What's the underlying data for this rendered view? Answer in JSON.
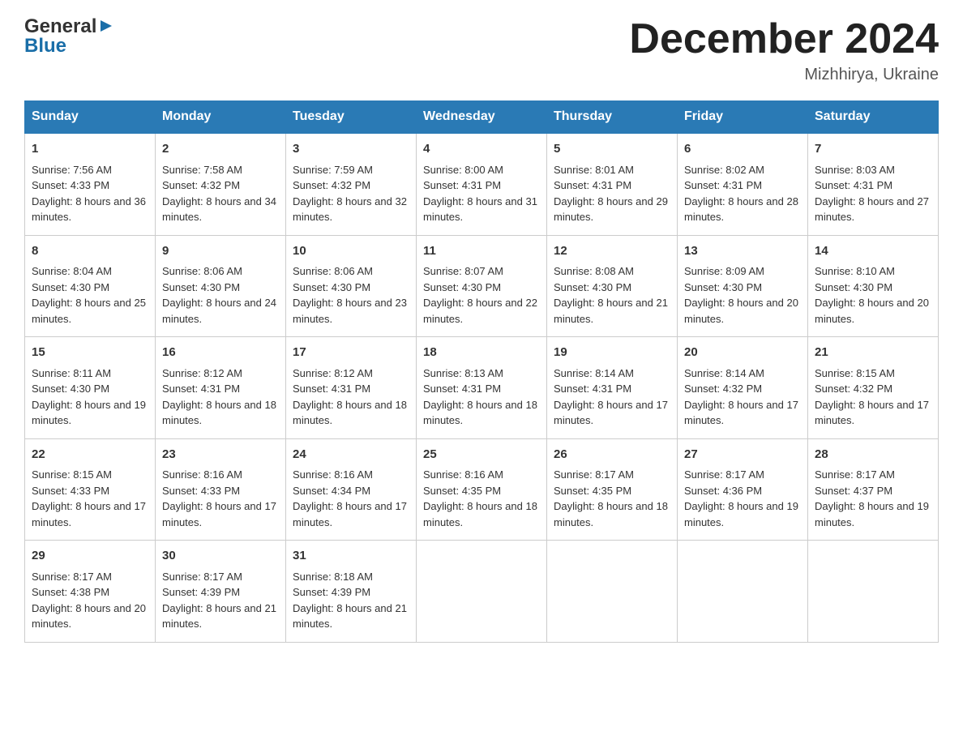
{
  "header": {
    "logo_general": "General",
    "logo_blue": "Blue",
    "month_title": "December 2024",
    "location": "Mizhhirya, Ukraine"
  },
  "days_of_week": [
    "Sunday",
    "Monday",
    "Tuesday",
    "Wednesday",
    "Thursday",
    "Friday",
    "Saturday"
  ],
  "weeks": [
    [
      {
        "day": "1",
        "sunrise": "7:56 AM",
        "sunset": "4:33 PM",
        "daylight": "8 hours and 36 minutes."
      },
      {
        "day": "2",
        "sunrise": "7:58 AM",
        "sunset": "4:32 PM",
        "daylight": "8 hours and 34 minutes."
      },
      {
        "day": "3",
        "sunrise": "7:59 AM",
        "sunset": "4:32 PM",
        "daylight": "8 hours and 32 minutes."
      },
      {
        "day": "4",
        "sunrise": "8:00 AM",
        "sunset": "4:31 PM",
        "daylight": "8 hours and 31 minutes."
      },
      {
        "day": "5",
        "sunrise": "8:01 AM",
        "sunset": "4:31 PM",
        "daylight": "8 hours and 29 minutes."
      },
      {
        "day": "6",
        "sunrise": "8:02 AM",
        "sunset": "4:31 PM",
        "daylight": "8 hours and 28 minutes."
      },
      {
        "day": "7",
        "sunrise": "8:03 AM",
        "sunset": "4:31 PM",
        "daylight": "8 hours and 27 minutes."
      }
    ],
    [
      {
        "day": "8",
        "sunrise": "8:04 AM",
        "sunset": "4:30 PM",
        "daylight": "8 hours and 25 minutes."
      },
      {
        "day": "9",
        "sunrise": "8:06 AM",
        "sunset": "4:30 PM",
        "daylight": "8 hours and 24 minutes."
      },
      {
        "day": "10",
        "sunrise": "8:06 AM",
        "sunset": "4:30 PM",
        "daylight": "8 hours and 23 minutes."
      },
      {
        "day": "11",
        "sunrise": "8:07 AM",
        "sunset": "4:30 PM",
        "daylight": "8 hours and 22 minutes."
      },
      {
        "day": "12",
        "sunrise": "8:08 AM",
        "sunset": "4:30 PM",
        "daylight": "8 hours and 21 minutes."
      },
      {
        "day": "13",
        "sunrise": "8:09 AM",
        "sunset": "4:30 PM",
        "daylight": "8 hours and 20 minutes."
      },
      {
        "day": "14",
        "sunrise": "8:10 AM",
        "sunset": "4:30 PM",
        "daylight": "8 hours and 20 minutes."
      }
    ],
    [
      {
        "day": "15",
        "sunrise": "8:11 AM",
        "sunset": "4:30 PM",
        "daylight": "8 hours and 19 minutes."
      },
      {
        "day": "16",
        "sunrise": "8:12 AM",
        "sunset": "4:31 PM",
        "daylight": "8 hours and 18 minutes."
      },
      {
        "day": "17",
        "sunrise": "8:12 AM",
        "sunset": "4:31 PM",
        "daylight": "8 hours and 18 minutes."
      },
      {
        "day": "18",
        "sunrise": "8:13 AM",
        "sunset": "4:31 PM",
        "daylight": "8 hours and 18 minutes."
      },
      {
        "day": "19",
        "sunrise": "8:14 AM",
        "sunset": "4:31 PM",
        "daylight": "8 hours and 17 minutes."
      },
      {
        "day": "20",
        "sunrise": "8:14 AM",
        "sunset": "4:32 PM",
        "daylight": "8 hours and 17 minutes."
      },
      {
        "day": "21",
        "sunrise": "8:15 AM",
        "sunset": "4:32 PM",
        "daylight": "8 hours and 17 minutes."
      }
    ],
    [
      {
        "day": "22",
        "sunrise": "8:15 AM",
        "sunset": "4:33 PM",
        "daylight": "8 hours and 17 minutes."
      },
      {
        "day": "23",
        "sunrise": "8:16 AM",
        "sunset": "4:33 PM",
        "daylight": "8 hours and 17 minutes."
      },
      {
        "day": "24",
        "sunrise": "8:16 AM",
        "sunset": "4:34 PM",
        "daylight": "8 hours and 17 minutes."
      },
      {
        "day": "25",
        "sunrise": "8:16 AM",
        "sunset": "4:35 PM",
        "daylight": "8 hours and 18 minutes."
      },
      {
        "day": "26",
        "sunrise": "8:17 AM",
        "sunset": "4:35 PM",
        "daylight": "8 hours and 18 minutes."
      },
      {
        "day": "27",
        "sunrise": "8:17 AM",
        "sunset": "4:36 PM",
        "daylight": "8 hours and 19 minutes."
      },
      {
        "day": "28",
        "sunrise": "8:17 AM",
        "sunset": "4:37 PM",
        "daylight": "8 hours and 19 minutes."
      }
    ],
    [
      {
        "day": "29",
        "sunrise": "8:17 AM",
        "sunset": "4:38 PM",
        "daylight": "8 hours and 20 minutes."
      },
      {
        "day": "30",
        "sunrise": "8:17 AM",
        "sunset": "4:39 PM",
        "daylight": "8 hours and 21 minutes."
      },
      {
        "day": "31",
        "sunrise": "8:18 AM",
        "sunset": "4:39 PM",
        "daylight": "8 hours and 21 minutes."
      },
      {
        "day": "",
        "sunrise": "",
        "sunset": "",
        "daylight": ""
      },
      {
        "day": "",
        "sunrise": "",
        "sunset": "",
        "daylight": ""
      },
      {
        "day": "",
        "sunrise": "",
        "sunset": "",
        "daylight": ""
      },
      {
        "day": "",
        "sunrise": "",
        "sunset": "",
        "daylight": ""
      }
    ]
  ],
  "labels": {
    "sunrise": "Sunrise:",
    "sunset": "Sunset:",
    "daylight": "Daylight:"
  }
}
